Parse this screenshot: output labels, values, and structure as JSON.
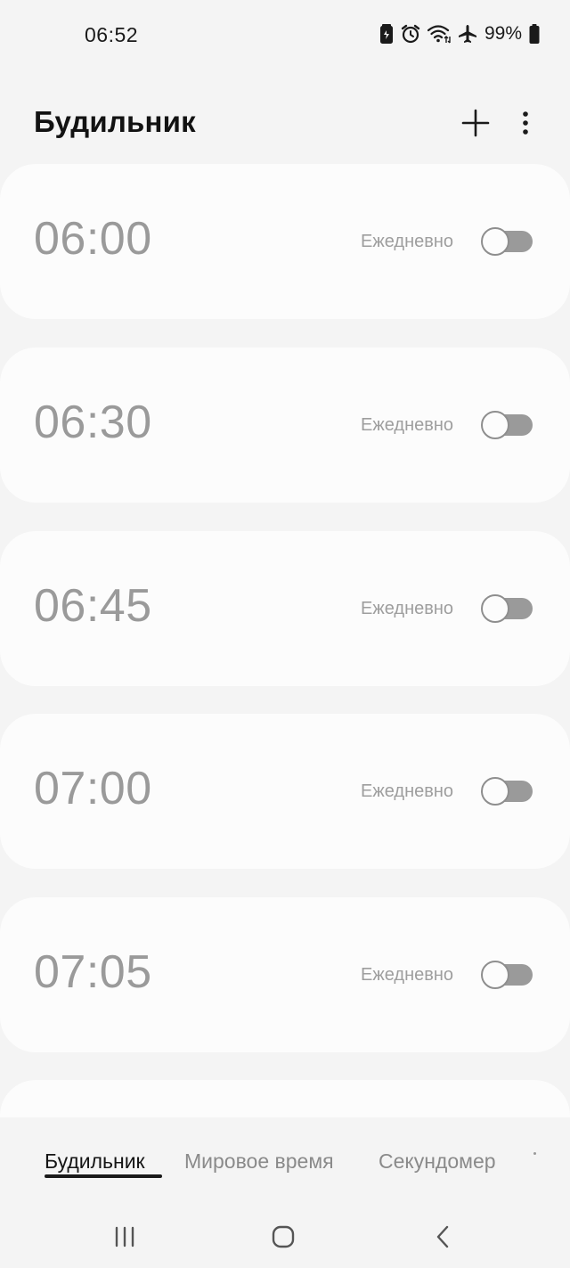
{
  "status_bar": {
    "time": "06:52",
    "battery_percent": "99%",
    "icons": [
      "battery-saver-icon",
      "alarm-icon",
      "wifi-icon",
      "airplane-mode-icon",
      "battery-icon"
    ]
  },
  "header": {
    "title": "Будильник",
    "add_icon": "plus-icon",
    "more_icon": "more-vertical-icon"
  },
  "alarms": [
    {
      "time": "06:00",
      "repeat": "Ежедневно",
      "enabled": false
    },
    {
      "time": "06:30",
      "repeat": "Ежедневно",
      "enabled": false
    },
    {
      "time": "06:45",
      "repeat": "Ежедневно",
      "enabled": false
    },
    {
      "time": "07:00",
      "repeat": "Ежедневно",
      "enabled": false
    },
    {
      "time": "07:05",
      "repeat": "Ежедневно",
      "enabled": false
    }
  ],
  "tabs": [
    {
      "label": "Будильник",
      "active": true
    },
    {
      "label": "Мировое время",
      "active": false
    },
    {
      "label": "Секундомер",
      "active": false
    }
  ],
  "nav_bar": {
    "icons": [
      "recent-apps-icon",
      "home-icon",
      "back-icon"
    ]
  },
  "colors": {
    "background": "#f4f4f4",
    "card": "#fcfcfc",
    "inactive_text": "#9a9a9a",
    "active_tab": "#151515"
  }
}
